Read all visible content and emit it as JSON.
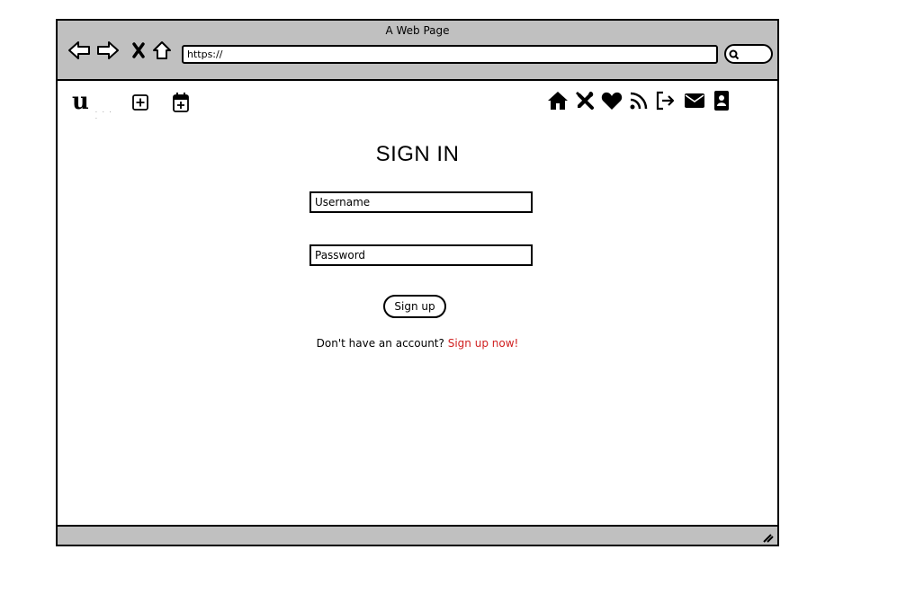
{
  "window": {
    "title": "A Web Page",
    "url": "https://"
  },
  "icons": {
    "nav": [
      "back-arrow-icon",
      "forward-arrow-icon",
      "close-x-icon",
      "home-outline-icon"
    ],
    "toolbar_left": [
      "add-square-icon",
      "calendar-add-icon"
    ],
    "toolbar_right": [
      "home-icon",
      "tools-icon",
      "heart-icon",
      "rss-feed-icon",
      "sign-out-icon",
      "envelope-icon",
      "contact-card-icon"
    ]
  },
  "form": {
    "heading": "SIGN IN",
    "username_placeholder": "Username",
    "password_placeholder": "Password",
    "submit_label": "Sign up",
    "account_prompt": "Don't have an account?",
    "signup_link": "Sign up now!"
  },
  "colors": {
    "chrome": "#c0c0c0",
    "link": "#d02020"
  }
}
